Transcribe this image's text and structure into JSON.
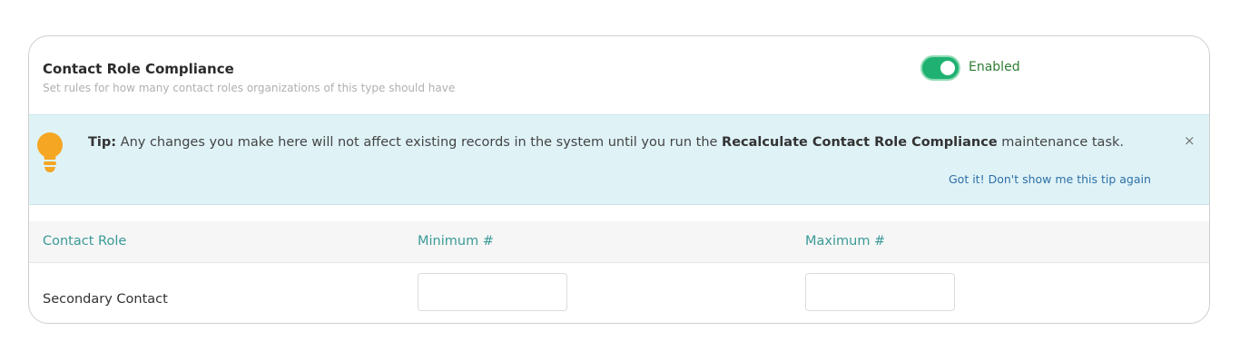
{
  "panel": {
    "title": "Contact Role Compliance",
    "subtitle": "Set rules for how many contact roles organizations of this type should have",
    "toggle_state": "on",
    "toggle_label": "Enabled"
  },
  "tip": {
    "icon": "lightbulb-icon",
    "prefix": "Tip:",
    "text_before": " Any changes you make here will not affect existing records in the system until you run the ",
    "highlight": "Recalculate Contact Role Compliance",
    "text_after": " maintenance task.",
    "close_glyph": "×",
    "dismiss_label": "Got it! Don't show me this tip again"
  },
  "table": {
    "columns": [
      "Contact Role",
      "Minimum #",
      "Maximum #"
    ],
    "rows": [
      {
        "role": "Secondary Contact",
        "minimum": "",
        "maximum": ""
      }
    ]
  },
  "colors": {
    "toggle_on": "#1fb172",
    "enabled_text": "#2e7d32",
    "tip_background": "#dff3f7",
    "column_header_text": "#3a9a96",
    "link": "#2f6fa6",
    "bulb": "#f5a623"
  }
}
